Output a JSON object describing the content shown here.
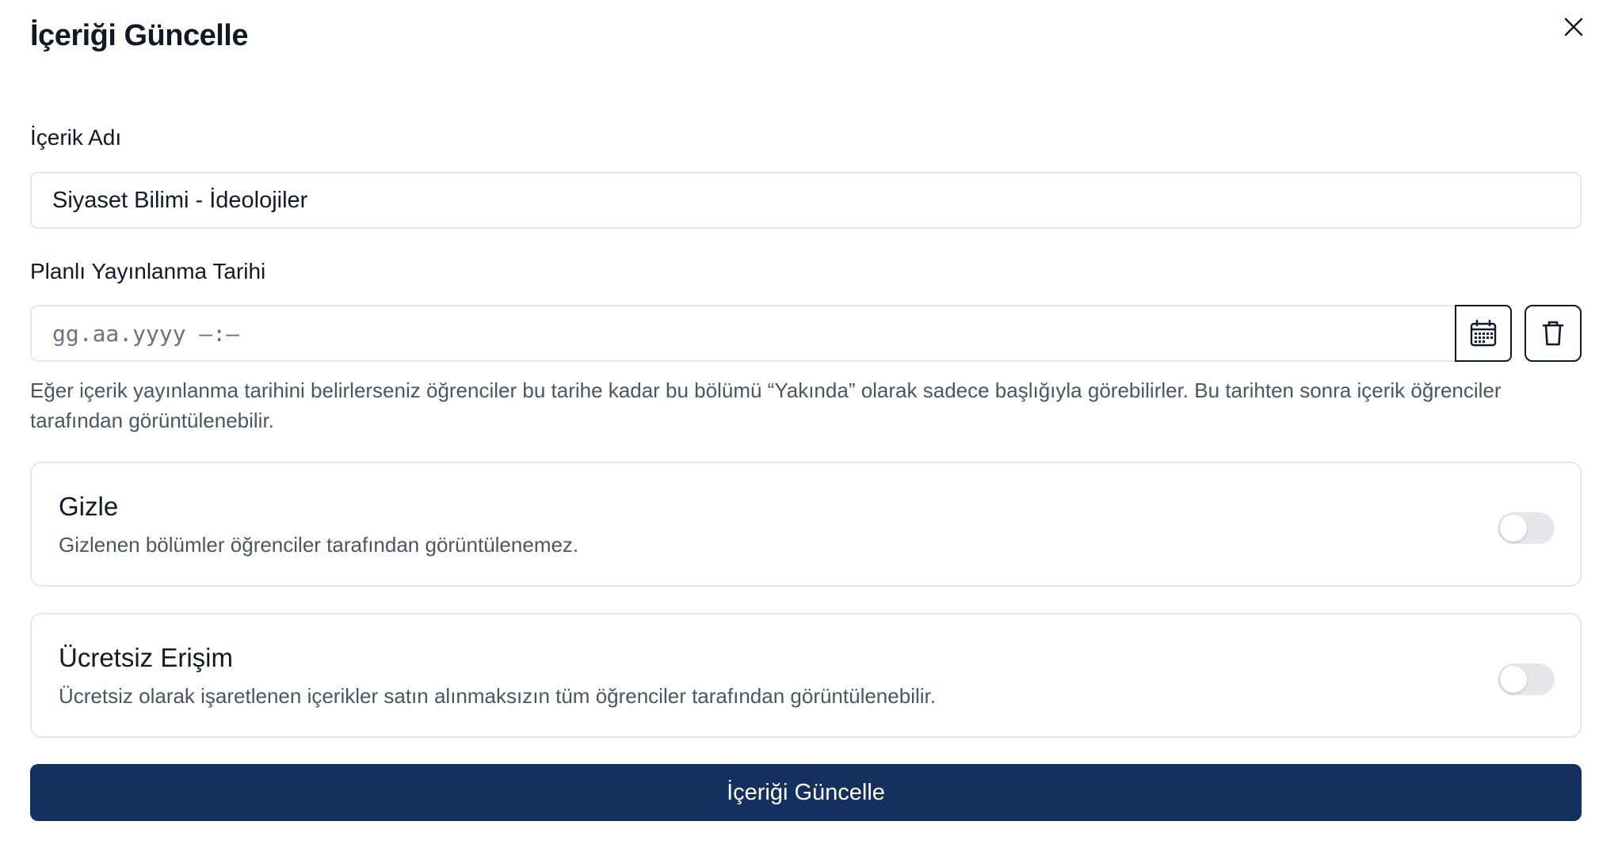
{
  "modal": {
    "title": "İçeriği Güncelle",
    "close_icon": "close-icon"
  },
  "content_name": {
    "label": "İçerik Adı",
    "value": "Siyaset Bilimi - İdeolojiler"
  },
  "publish_date": {
    "label": "Planlı Yayınlanma Tarihi",
    "placeholder": "gg.aa.yyyy —:—",
    "calendar_icon": "calendar-icon",
    "delete_icon": "trash-icon",
    "help_text": "Eğer içerik yayınlanma tarihini belirlerseniz öğrenciler bu tarihe kadar bu bölümü “Yakında” olarak sadece başlığıyla görebilirler. Bu tarihten sonra içerik öğrenciler tarafından görüntülenebilir."
  },
  "hide_option": {
    "title": "Gizle",
    "description": "Gizlenen bölümler öğrenciler tarafından görüntülenemez.",
    "enabled": false
  },
  "free_access_option": {
    "title": "Ücretsiz Erişim",
    "description": "Ücretsiz olarak işaretlenen içerikler satın alınmaksızın tüm öğrenciler tarafından görüntülenebilir.",
    "enabled": false
  },
  "submit": {
    "label": "İçeriği Güncelle"
  },
  "colors": {
    "primary_button": "#14305e",
    "border": "#e5e7eb",
    "muted_text": "#4b5563",
    "toggle_off": "#e5e7eb"
  }
}
